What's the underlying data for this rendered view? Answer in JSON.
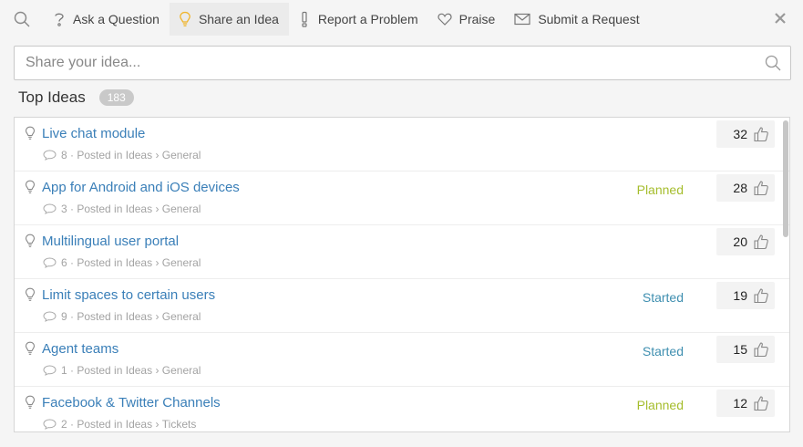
{
  "tabs": [
    {
      "label": "Ask a Question",
      "icon": "question-icon"
    },
    {
      "label": "Share an Idea",
      "icon": "lightbulb-icon",
      "active": true
    },
    {
      "label": "Report a Problem",
      "icon": "exclamation-icon"
    },
    {
      "label": "Praise",
      "icon": "heart-icon"
    },
    {
      "label": "Submit a Request",
      "icon": "envelope-icon"
    }
  ],
  "search": {
    "placeholder": "Share your idea..."
  },
  "section": {
    "title": "Top Ideas",
    "count": "183"
  },
  "ideas": [
    {
      "title": "Live chat module",
      "comments": "8",
      "posted_in": "Posted in",
      "forum": "Ideas",
      "category": "General",
      "status": "",
      "votes": "32"
    },
    {
      "title": "App for Android and iOS devices",
      "comments": "3",
      "posted_in": "Posted in",
      "forum": "Ideas",
      "category": "General",
      "status": "Planned",
      "votes": "28"
    },
    {
      "title": "Multilingual user portal",
      "comments": "6",
      "posted_in": "Posted in",
      "forum": "Ideas",
      "category": "General",
      "status": "",
      "votes": "20"
    },
    {
      "title": "Limit spaces to certain users",
      "comments": "9",
      "posted_in": "Posted in",
      "forum": "Ideas",
      "category": "General",
      "status": "Started",
      "votes": "19"
    },
    {
      "title": "Agent teams",
      "comments": "1",
      "posted_in": "Posted in",
      "forum": "Ideas",
      "category": "General",
      "status": "Started",
      "votes": "15"
    },
    {
      "title": "Facebook & Twitter Channels",
      "comments": "2",
      "posted_in": "Posted in",
      "forum": "Ideas",
      "category": "Tickets",
      "status": "Planned",
      "votes": "12"
    }
  ],
  "colors": {
    "link": "#3a7fb8",
    "planned": "#a5bd2c",
    "started": "#3f8fb0",
    "active_icon": "#f0b429"
  }
}
